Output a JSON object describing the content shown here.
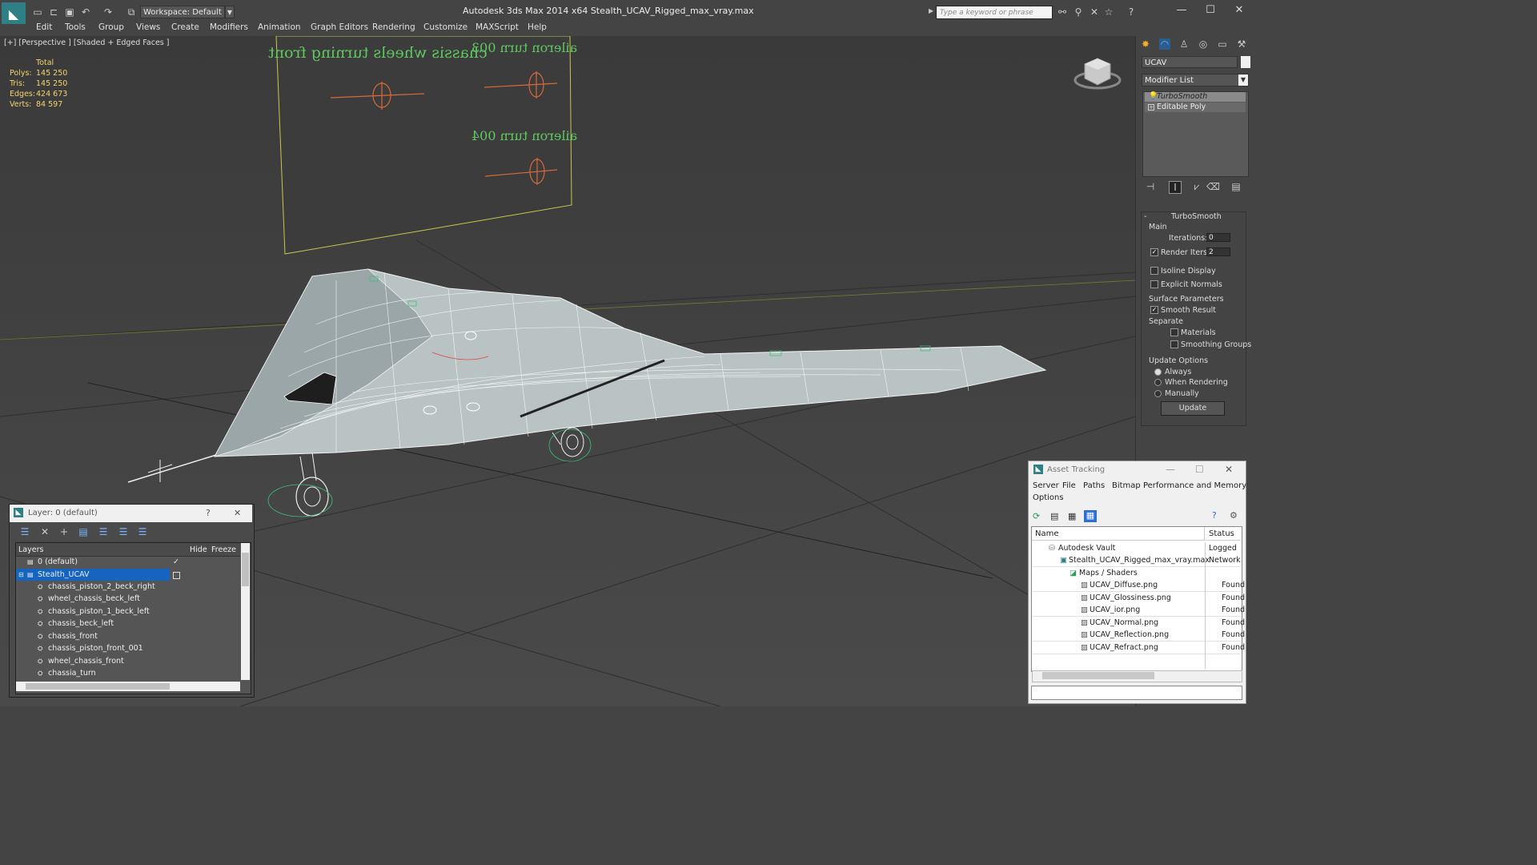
{
  "app": {
    "title": "Autodesk 3ds Max  2014 x64     Stealth_UCAV_Rigged_max_vray.max",
    "workspace": "Workspace: Default",
    "search_placeholder": "Type a keyword or phrase"
  },
  "menu": [
    "Edit",
    "Tools",
    "Group",
    "Views",
    "Create",
    "Modifiers",
    "Animation",
    "Graph Editors",
    "Rendering",
    "Customize",
    "MAXScript",
    "Help"
  ],
  "viewport": {
    "label": "[+] [Perspective ] [Shaded + Edged Faces ]",
    "stats_header": "Total",
    "stats": [
      {
        "label": "Polys:",
        "value": "145 250"
      },
      {
        "label": "Tris:",
        "value": "145 250"
      },
      {
        "label": "Edges:",
        "value": "424 673"
      },
      {
        "label": "Verts:",
        "value": "84 597"
      }
    ],
    "board_texts": [
      "chassis wheels turning front",
      "aileron turn 003",
      "aileron turn 004"
    ]
  },
  "command_panel": {
    "object_name": "UCAV",
    "modifier_list": "Modifier List",
    "stack": [
      "TurboSmooth",
      "Editable Poly"
    ],
    "rollout_title": "TurboSmooth",
    "main_label": "Main",
    "iterations_label": "Iterations:",
    "iterations_value": "0",
    "render_iters_label": "Render Iters:",
    "render_iters_value": "2",
    "isoline_label": "Isoline Display",
    "explicit_normals_label": "Explicit Normals",
    "surface_params_label": "Surface Parameters",
    "smooth_result_label": "Smooth Result",
    "separate_label": "Separate",
    "materials_label": "Materials",
    "smoothing_groups_label": "Smoothing Groups",
    "update_options_label": "Update Options",
    "always_label": "Always",
    "when_rendering_label": "When Rendering",
    "manually_label": "Manually",
    "update_button": "Update"
  },
  "layer_dialog": {
    "title": "Layer: 0 (default)",
    "help": "?",
    "close": "✕",
    "col_layers": "Layers",
    "col_hide": "Hide",
    "col_freeze": "Freeze",
    "rows": [
      {
        "name": "0 (default)",
        "indent": 0
      },
      {
        "name": "Stealth_UCAV",
        "indent": 0
      },
      {
        "name": "chassis_piston_2_beck_right",
        "indent": 1
      },
      {
        "name": "wheel_chassis_beck_left",
        "indent": 1
      },
      {
        "name": "chassis_piston_1_beck_left",
        "indent": 1
      },
      {
        "name": "chassis_beck_left",
        "indent": 1
      },
      {
        "name": "chassis_front",
        "indent": 1
      },
      {
        "name": "chassis_piston_front_001",
        "indent": 1
      },
      {
        "name": "wheel_chassis_front",
        "indent": 1
      },
      {
        "name": "chassia_turn",
        "indent": 1
      }
    ]
  },
  "asset_tracking": {
    "title": "Asset Tracking",
    "menu": [
      "Server",
      "File",
      "Paths",
      "Bitmap Performance and Memory"
    ],
    "menu2": "Options",
    "col_name": "Name",
    "col_status": "Status",
    "rows": [
      {
        "name": "Autodesk Vault",
        "status": "Logged C",
        "indent": 0
      },
      {
        "name": "Stealth_UCAV_Rigged_max_vray.max",
        "status": "Network I",
        "indent": 1
      },
      {
        "name": "Maps / Shaders",
        "status": "",
        "indent": 2
      },
      {
        "name": "UCAV_Diffuse.png",
        "status": "Found",
        "indent": 3
      },
      {
        "name": "UCAV_Glossiness.png",
        "status": "Found",
        "indent": 3
      },
      {
        "name": "UCAV_ior.png",
        "status": "Found",
        "indent": 3
      },
      {
        "name": "UCAV_Normal.png",
        "status": "Found",
        "indent": 3
      },
      {
        "name": "UCAV_Reflection.png",
        "status": "Found",
        "indent": 3
      },
      {
        "name": "UCAV_Refract.png",
        "status": "Found",
        "indent": 3
      }
    ]
  }
}
